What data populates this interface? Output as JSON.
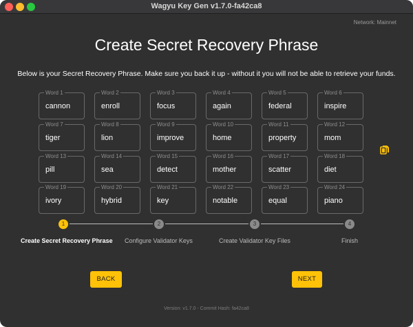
{
  "window": {
    "title": "Wagyu Key Gen v1.7.0-fa42ca8"
  },
  "network": "Network: Mainnet",
  "page": {
    "heading": "Create Secret Recovery Phrase",
    "subtext": "Below is your Secret Recovery Phrase. Make sure you back it up - without it you will not be able to retrieve your funds."
  },
  "words": [
    {
      "label": "Word 1",
      "value": "cannon"
    },
    {
      "label": "Word 2",
      "value": "enroll"
    },
    {
      "label": "Word 3",
      "value": "focus"
    },
    {
      "label": "Word 4",
      "value": "again"
    },
    {
      "label": "Word 5",
      "value": "federal"
    },
    {
      "label": "Word 6",
      "value": "inspire"
    },
    {
      "label": "Word 7",
      "value": "tiger"
    },
    {
      "label": "Word 8",
      "value": "lion"
    },
    {
      "label": "Word 9",
      "value": "improve"
    },
    {
      "label": "Word 10",
      "value": "home"
    },
    {
      "label": "Word 11",
      "value": "property"
    },
    {
      "label": "Word 12",
      "value": "mom"
    },
    {
      "label": "Word 13",
      "value": "pill"
    },
    {
      "label": "Word 14",
      "value": "sea"
    },
    {
      "label": "Word 15",
      "value": "detect"
    },
    {
      "label": "Word 16",
      "value": "mother"
    },
    {
      "label": "Word 17",
      "value": "scatter"
    },
    {
      "label": "Word 18",
      "value": "diet"
    },
    {
      "label": "Word 19",
      "value": "ivory"
    },
    {
      "label": "Word 20",
      "value": "hybrid"
    },
    {
      "label": "Word 21",
      "value": "key"
    },
    {
      "label": "Word 22",
      "value": "notable"
    },
    {
      "label": "Word 23",
      "value": "equal"
    },
    {
      "label": "Word 24",
      "value": "piano"
    }
  ],
  "copy_icon": "copy-icon",
  "stepper": {
    "active_index": 0,
    "steps": [
      {
        "number": "1",
        "label": "Create Secret Recovery Phrase"
      },
      {
        "number": "2",
        "label": "Configure Validator Keys"
      },
      {
        "number": "3",
        "label": "Create Validator Key Files"
      },
      {
        "number": "4",
        "label": "Finish"
      }
    ]
  },
  "buttons": {
    "back": "BACK",
    "next": "NEXT"
  },
  "colors": {
    "accent": "#ffc208",
    "background": "#303030",
    "border": "#6a6a6a"
  },
  "footer": "Version: v1.7.0 - Commit Hash: fa42ca8"
}
